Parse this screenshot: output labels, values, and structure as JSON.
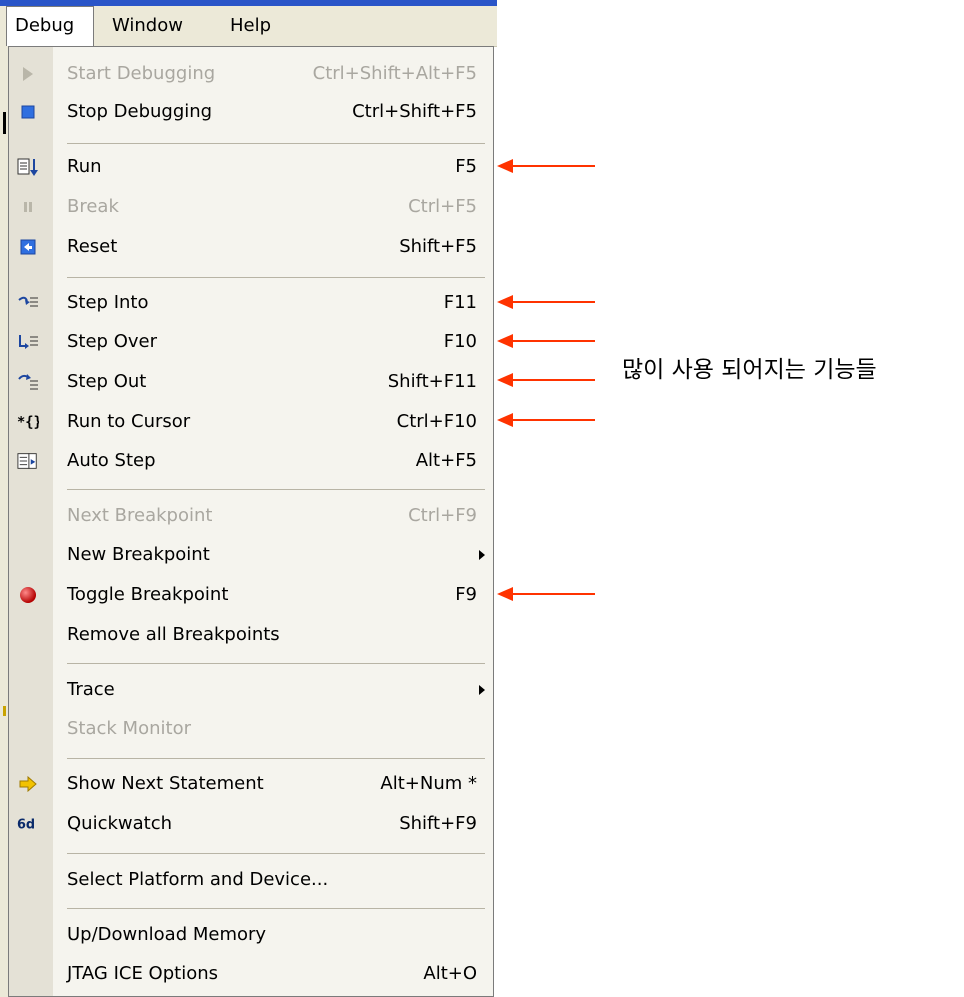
{
  "menubar": {
    "debug": "Debug",
    "window": "Window",
    "help": "Help"
  },
  "menu": {
    "items": [
      {
        "label": "Start Debugging",
        "shortcut": "Ctrl+Shift+Alt+F5",
        "icon": "play-icon",
        "disabled": true
      },
      {
        "label": "Stop Debugging",
        "shortcut": "Ctrl+Shift+F5",
        "icon": "stop-icon"
      },
      {
        "label": "Run",
        "shortcut": "F5",
        "icon": "run-icon"
      },
      {
        "label": "Break",
        "shortcut": "Ctrl+F5",
        "icon": "pause-icon",
        "disabled": true
      },
      {
        "label": "Reset",
        "shortcut": "Shift+F5",
        "icon": "reset-icon"
      },
      {
        "label": "Step Into",
        "shortcut": "F11",
        "icon": "step-into-icon"
      },
      {
        "label": "Step Over",
        "shortcut": "F10",
        "icon": "step-over-icon"
      },
      {
        "label": "Step Out",
        "shortcut": "Shift+F11",
        "icon": "step-out-icon"
      },
      {
        "label": "Run to Cursor",
        "shortcut": "Ctrl+F10",
        "icon": "run-to-cursor-icon"
      },
      {
        "label": "Auto Step",
        "shortcut": "Alt+F5",
        "icon": "auto-step-icon"
      },
      {
        "label": "Next Breakpoint",
        "shortcut": "Ctrl+F9",
        "disabled": true
      },
      {
        "label": "New Breakpoint",
        "shortcut": "",
        "submenu": true
      },
      {
        "label": "Toggle Breakpoint",
        "shortcut": "F9",
        "icon": "breakpoint-icon"
      },
      {
        "label": "Remove all Breakpoints",
        "shortcut": ""
      },
      {
        "label": "Trace",
        "shortcut": "",
        "submenu": true
      },
      {
        "label": "Stack Monitor",
        "shortcut": "",
        "disabled": true
      },
      {
        "label": "Show Next Statement",
        "shortcut": "Alt+Num *",
        "icon": "next-statement-icon"
      },
      {
        "label": "Quickwatch",
        "shortcut": "Shift+F9",
        "icon": "quickwatch-icon"
      },
      {
        "label": "Select Platform and Device...",
        "shortcut": ""
      },
      {
        "label": "Up/Download Memory",
        "shortcut": ""
      },
      {
        "label": "JTAG ICE Options",
        "shortcut": "Alt+O"
      }
    ]
  },
  "annotation": "많이 사용 되어지는 기능들",
  "colors": {
    "arrow": "#ff3300",
    "menubar": "#ece9d8",
    "menu_bg": "#f5f4ee",
    "gutter": "#e4e1d6",
    "disabled": "#a9a7a0"
  }
}
